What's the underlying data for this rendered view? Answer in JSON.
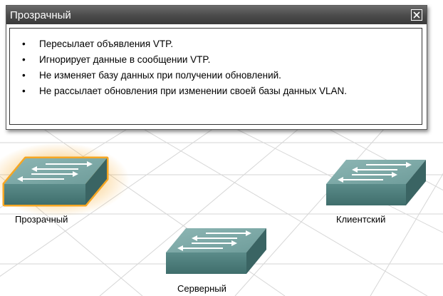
{
  "popup": {
    "title": "Прозрачный",
    "close_label": "Закрыть",
    "bullet_char": "•",
    "items": [
      "Пересылает объявления VTP.",
      "Игнорирует данные в сообщении VTP.",
      "Не изменяет базу данных при получении обновлений.",
      "Не рассылает обновления при изменении своей базы данных VLAN."
    ]
  },
  "switches": [
    {
      "label": "Прозрачный",
      "highlighted": true
    },
    {
      "label": "Клиентский",
      "highlighted": false
    },
    {
      "label": "Серверный",
      "highlighted": false
    }
  ],
  "colors": {
    "switch_top": "#7fa9a8",
    "switch_front": "#4f7f7e",
    "switch_side": "#3a6463",
    "highlight": "#f5a623",
    "grid": "#d4d4d4"
  }
}
